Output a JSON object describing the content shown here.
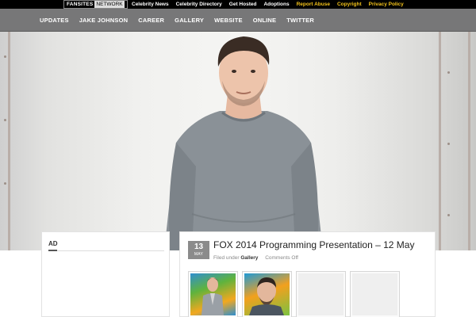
{
  "topbar": {
    "brand_main": "FANSITES",
    "brand_sub": "NETWORK",
    "links": [
      {
        "label": "Celebrity News",
        "highlight": false
      },
      {
        "label": "Celebrity Directory",
        "highlight": false
      },
      {
        "label": "Get Hosted",
        "highlight": false
      },
      {
        "label": "Adoptions",
        "highlight": false
      },
      {
        "label": "Report Abuse",
        "highlight": true
      },
      {
        "label": "Copyright",
        "highlight": true
      },
      {
        "label": "Privacy Policy",
        "highlight": true
      }
    ]
  },
  "nav": {
    "items": [
      "UPDATES",
      "JAKE JOHNSON",
      "CAREER",
      "GALLERY",
      "WEBSITE",
      "ONLINE",
      "TWITTER"
    ]
  },
  "sidebar": {
    "title": "AD"
  },
  "post": {
    "day": "13",
    "month": "MAY",
    "title": "FOX 2014 Programming Presentation – 12 May",
    "filed_prefix": "Filed under",
    "category": "Gallery",
    "comments": "Comments Off"
  },
  "colors": {
    "accent": "#f3c21a",
    "nav_bg": "#777778",
    "date_bg": "#8b8b8b"
  }
}
